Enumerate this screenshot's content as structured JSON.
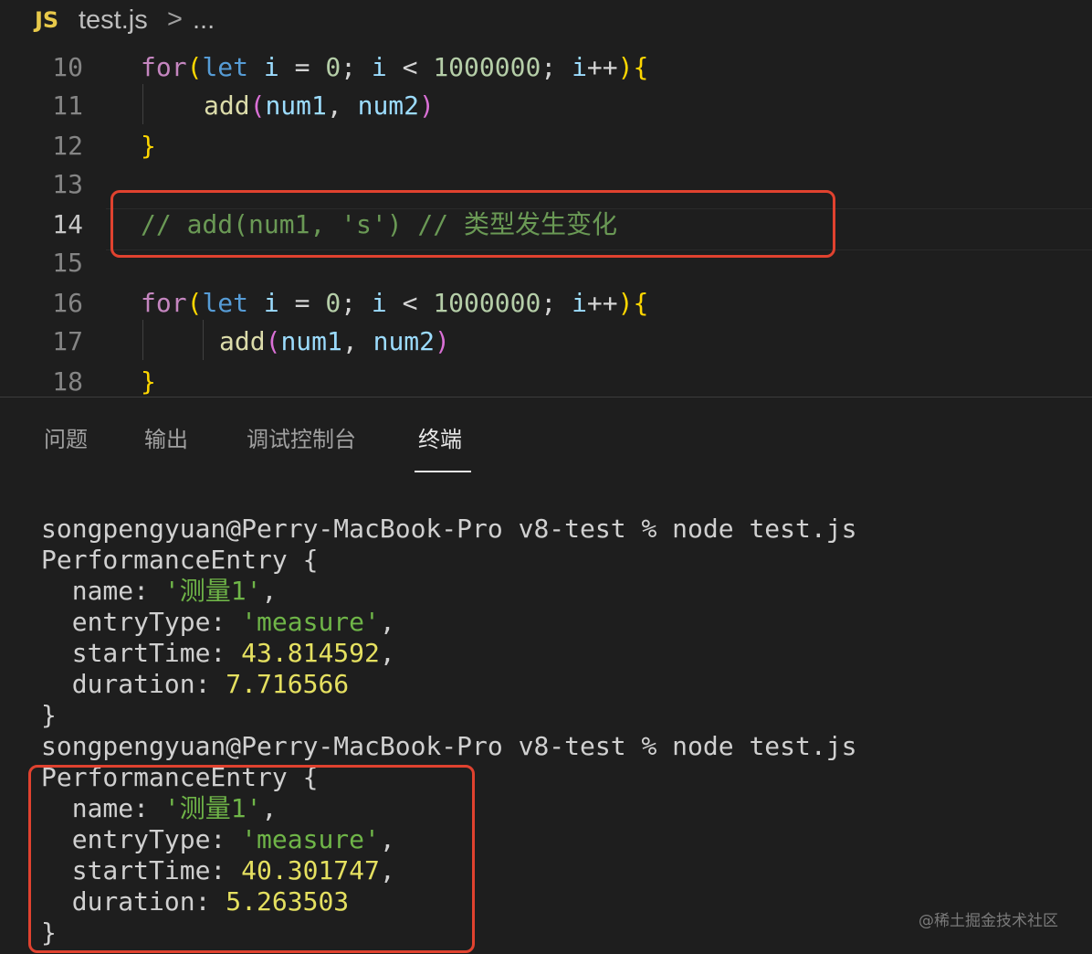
{
  "breadcrumb": {
    "lang_icon": "JS",
    "file": "test.js",
    "separator": ">",
    "more": "..."
  },
  "editor": {
    "lines": [
      {
        "num": "10",
        "tokens": [
          [
            "kw",
            "for"
          ],
          [
            "br1",
            "("
          ],
          [
            "st",
            "let"
          ],
          [
            "pl",
            " "
          ],
          [
            "var",
            "i"
          ],
          [
            "pl",
            " = "
          ],
          [
            "num",
            "0"
          ],
          [
            "pl",
            "; "
          ],
          [
            "var",
            "i"
          ],
          [
            "pl",
            " < "
          ],
          [
            "num",
            "1000000"
          ],
          [
            "pl",
            "; "
          ],
          [
            "var",
            "i"
          ],
          [
            "pl",
            "++"
          ],
          [
            "br1",
            ")"
          ],
          [
            "br1",
            "{"
          ]
        ]
      },
      {
        "num": "11",
        "tokens": [
          [
            "fn",
            "add"
          ],
          [
            "br2",
            "("
          ],
          [
            "var",
            "num1"
          ],
          [
            "pl",
            ", "
          ],
          [
            "var",
            "num2"
          ],
          [
            "br2",
            ")"
          ]
        ]
      },
      {
        "num": "12",
        "tokens": [
          [
            "br1",
            "}"
          ]
        ]
      },
      {
        "num": "13",
        "tokens": []
      },
      {
        "num": "14",
        "tokens": [
          [
            "cm",
            "// add(num1, 's') // 类型发生变化"
          ]
        ]
      },
      {
        "num": "15",
        "tokens": []
      },
      {
        "num": "16",
        "tokens": [
          [
            "kw",
            "for"
          ],
          [
            "br1",
            "("
          ],
          [
            "st",
            "let"
          ],
          [
            "pl",
            " "
          ],
          [
            "var",
            "i"
          ],
          [
            "pl",
            " = "
          ],
          [
            "num",
            "0"
          ],
          [
            "pl",
            "; "
          ],
          [
            "var",
            "i"
          ],
          [
            "pl",
            " < "
          ],
          [
            "num",
            "1000000"
          ],
          [
            "pl",
            "; "
          ],
          [
            "var",
            "i"
          ],
          [
            "pl",
            "++"
          ],
          [
            "br1",
            ")"
          ],
          [
            "br1",
            "{"
          ]
        ]
      },
      {
        "num": "17",
        "tokens": [
          [
            "fn",
            "add"
          ],
          [
            "br2",
            "("
          ],
          [
            "var",
            "num1"
          ],
          [
            "pl",
            ", "
          ],
          [
            "var",
            "num2"
          ],
          [
            "br2",
            ")"
          ]
        ]
      },
      {
        "num": "18",
        "tokens": [
          [
            "br1",
            "}"
          ]
        ]
      }
    ]
  },
  "panel": {
    "tabs": [
      {
        "label": "问题"
      },
      {
        "label": "输出"
      },
      {
        "label": "调试控制台"
      },
      {
        "label": "终端",
        "active": true
      }
    ]
  },
  "terminal": {
    "prompt1": "songpengyuan@Perry-MacBook-Pro v8-test % node test.js",
    "entry1": {
      "header": "PerformanceEntry {",
      "name_key": "  name: ",
      "name_val": "'测量1'",
      "name_end": ",",
      "type_key": "  entryType: ",
      "type_val": "'measure'",
      "type_end": ",",
      "start_key": "  startTime: ",
      "start_val": "43.814592",
      "start_end": ",",
      "dur_key": "  duration: ",
      "dur_val": "7.716566",
      "close": "}"
    },
    "prompt2": "songpengyuan@Perry-MacBook-Pro v8-test % node test.js",
    "entry2": {
      "header": "PerformanceEntry {",
      "name_key": "  name: ",
      "name_val": "'测量1'",
      "name_end": ",",
      "type_key": "  entryType: ",
      "type_val": "'measure'",
      "type_end": ",",
      "start_key": "  startTime: ",
      "start_val": "40.301747",
      "start_end": ",",
      "dur_key": "  duration: ",
      "dur_val": "5.263503",
      "close": "}"
    }
  },
  "watermark": "@稀土掘金技术社区",
  "colors": {
    "highlight_box": "#e0422f",
    "background": "#1e1e1e"
  }
}
